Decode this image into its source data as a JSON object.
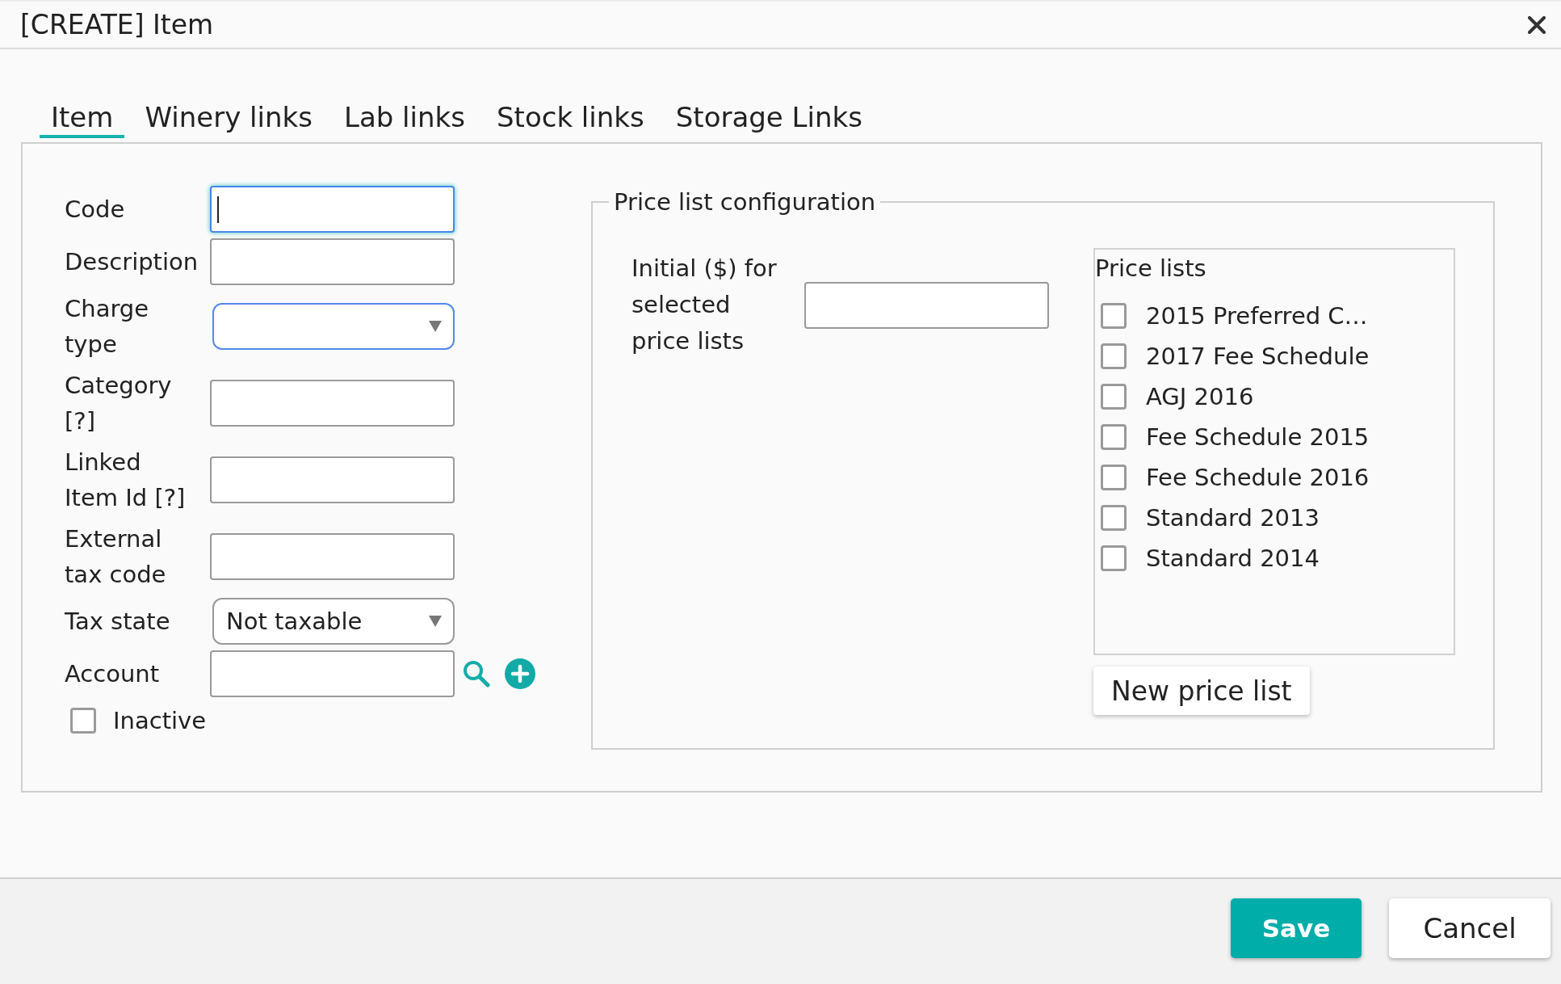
{
  "window": {
    "title": "[CREATE] Item"
  },
  "tabs": [
    {
      "label": "Item",
      "selected": true
    },
    {
      "label": "Winery links",
      "selected": false
    },
    {
      "label": "Lab links",
      "selected": false
    },
    {
      "label": "Stock links",
      "selected": false
    },
    {
      "label": "Storage Links",
      "selected": false
    }
  ],
  "form": {
    "fields": [
      {
        "label": "Code",
        "kind": "text",
        "focused": true,
        "highlighted": false
      },
      {
        "label": "Description",
        "kind": "text",
        "focused": false,
        "highlighted": false
      },
      {
        "label": "Charge type",
        "kind": "select",
        "focused": false,
        "highlighted": true
      },
      {
        "label": "Category [?]",
        "kind": "text",
        "focused": false,
        "highlighted": false
      },
      {
        "label": "Linked Item Id [?]",
        "kind": "text",
        "focused": false,
        "highlighted": false
      },
      {
        "label": "External tax code",
        "kind": "text",
        "focused": false,
        "highlighted": false
      },
      {
        "label": "Tax state",
        "kind": "select",
        "focused": false,
        "highlighted": false,
        "value": "Not taxable"
      },
      {
        "label": "Account",
        "kind": "lookup",
        "focused": false,
        "highlighted": false
      }
    ],
    "inactive": {
      "label": "Inactive",
      "checked": false
    }
  },
  "price_list_config": {
    "legend": "Price list configuration",
    "initial_label": "Initial ($) for selected price lists",
    "price_lists": {
      "title": "Price lists",
      "items": [
        {
          "label": "2015 Preferred C…",
          "checked": false
        },
        {
          "label": "2017 Fee Schedule",
          "checked": false
        },
        {
          "label": "AGJ 2016",
          "checked": false
        },
        {
          "label": "Fee Schedule 2015",
          "checked": false
        },
        {
          "label": "Fee Schedule 2016",
          "checked": false
        },
        {
          "label": "Standard 2013",
          "checked": false
        },
        {
          "label": "Standard 2014",
          "checked": false
        }
      ]
    },
    "new_button": "New price list"
  },
  "footer": {
    "buttons": [
      {
        "label": "Save",
        "kind": "primary"
      },
      {
        "label": "Cancel",
        "kind": "secondary"
      }
    ]
  }
}
